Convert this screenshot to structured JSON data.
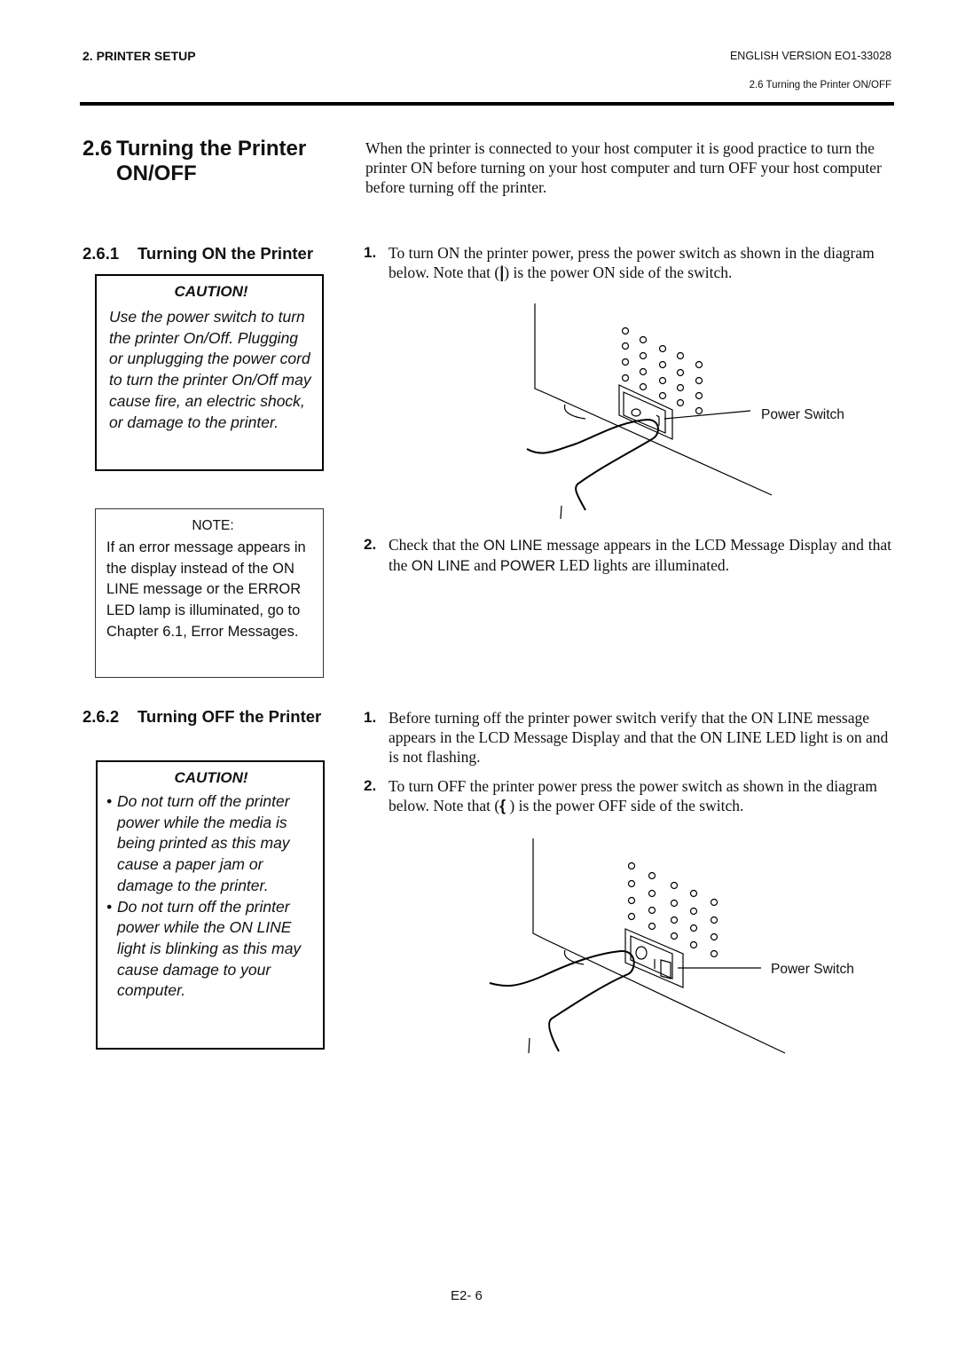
{
  "header": {
    "chapter": "2. PRINTER SETUP",
    "version": "ENGLISH VERSION EO1-33028",
    "section_ref": "2.6 Turning the Printer ON/OFF"
  },
  "section": {
    "number": "2.6",
    "title_line1": "Turning the Printer",
    "title_line2": "ON/OFF",
    "intro": "When the printer is connected to your host computer it is good practice to turn the printer ON before turning on your host computer and turn OFF your host computer before turning off the printer."
  },
  "turn_on": {
    "number": "2.6.1",
    "title": "Turning ON the Printer",
    "caution": {
      "title": "CAUTION!",
      "text": "Use the power switch to turn the printer On/Off. Plugging or unplugging the power cord to turn the printer On/Off may cause fire, an electric shock, or damage to the printer."
    },
    "note": {
      "title": "NOTE:",
      "text": "If an error message appears in the display instead of the ON LINE message or the ERROR LED lamp is illuminated, go to Chapter 6.1, Error Messages."
    },
    "steps": [
      {
        "num": "1.",
        "text_before": "To turn ON the printer power, press the power switch as shown in the diagram below.  Note that (",
        "symbol": "|",
        "text_after": ") is the power ON side of the switch."
      },
      {
        "num": "2.",
        "p1": "Check that the ",
        "k1": "ON LINE",
        "p2": " message appears in the LCD Message Display and that the ",
        "k2": "ON LINE",
        "p3": " and ",
        "k3": "POWER",
        "p4": " LED lights are illuminated."
      }
    ],
    "figure_label": "Power Switch"
  },
  "turn_off": {
    "number": "2.6.2",
    "title": "Turning OFF the Printer",
    "caution": {
      "title": "CAUTION!",
      "bullets": [
        "Do not turn off the printer power while the media is being printed as this may cause a paper jam or damage to the printer.",
        "Do not turn off the printer power while the ON LINE light is blinking as this may cause damage to your computer."
      ]
    },
    "steps": [
      {
        "num": "1.",
        "text": "Before turning off the printer power switch verify that the ON LINE message appears in the LCD Message Display and that the ON LINE LED light is on and is not flashing."
      },
      {
        "num": "2.",
        "text_before": "To turn OFF the printer power press the power switch as shown in the diagram below.  Note that (",
        "symbol": "{",
        "text_after": " ) is the power OFF side of the switch."
      }
    ],
    "figure_label": "Power Switch"
  },
  "footer": {
    "page": "E2- 6"
  }
}
